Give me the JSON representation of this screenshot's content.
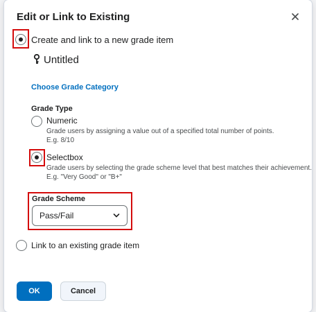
{
  "dialog": {
    "title": "Edit or Link to Existing",
    "close_icon": "close-icon"
  },
  "options": {
    "create_new": {
      "label": "Create and link to a new grade item",
      "checked": true
    },
    "link_existing": {
      "label": "Link to an existing grade item",
      "checked": false
    }
  },
  "grade_item": {
    "name": "Untitled",
    "icon": "key-icon",
    "choose_category_link": "Choose Grade Category"
  },
  "grade_type": {
    "heading": "Grade Type",
    "numeric": {
      "label": "Numeric",
      "desc": "Grade users by assigning a value out of a specified total number of points.",
      "example": "E.g. 8/10",
      "checked": false
    },
    "selectbox": {
      "label": "Selectbox",
      "desc": "Grade users by selecting the grade scheme level that best matches their achievement.",
      "example": "E.g. \"Very Good\" or \"B+\"",
      "checked": true
    }
  },
  "grade_scheme": {
    "heading": "Grade Scheme",
    "selected": "Pass/Fail"
  },
  "footer": {
    "ok_label": "OK",
    "cancel_label": "Cancel"
  },
  "colors": {
    "accent": "#006fbf",
    "highlight": "#d40b0b"
  }
}
